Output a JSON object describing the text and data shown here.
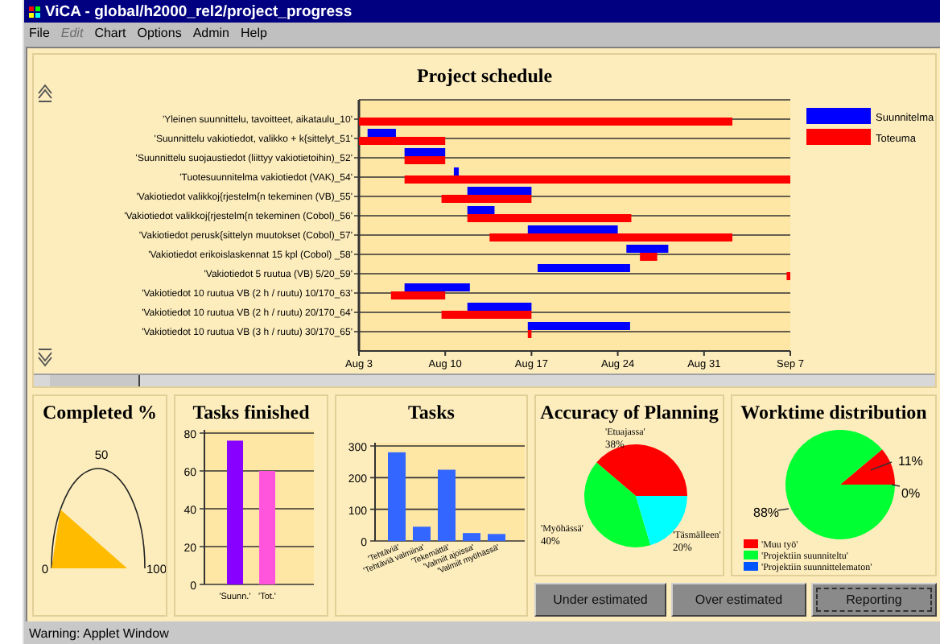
{
  "window": {
    "title": "ViCA - global/h2000_rel2/project_progress"
  },
  "menu": [
    {
      "label": "File",
      "disabled": false
    },
    {
      "label": "Edit",
      "disabled": true
    },
    {
      "label": "Chart",
      "disabled": false
    },
    {
      "label": "Options",
      "disabled": false
    },
    {
      "label": "Admin",
      "disabled": false
    },
    {
      "label": "Help",
      "disabled": false
    }
  ],
  "schedule": {
    "title": "Project schedule",
    "tasks": [
      {
        "label": "'Yleinen suunnittelu, tavoitteet, aikataulu_10'"
      },
      {
        "label": "'Suunnittelu vakiotiedot, valikko + k{sittelyt_51'"
      },
      {
        "label": "'Suunnittelu suojaustiedot (liittyy vakiotietoihin)_52'"
      },
      {
        "label": "'Tuotesuunnitelma vakiotiedot (VAK)_54'"
      },
      {
        "label": "'Vakiotiedot valikkoj{rjestelm{n tekeminen (VB)_55'"
      },
      {
        "label": "'Vakiotiedot valikkoj{rjestelm{n tekeminen (Cobol)_56'"
      },
      {
        "label": "'Vakiotiedot perusk{sittelyn muutokset (Cobol)_57'"
      },
      {
        "label": "'Vakiotiedot erikoislaskennat 15 kpl (Cobol) _58'"
      },
      {
        "label": "'Vakiotiedot 5 ruutua (VB)    5/20_59'"
      },
      {
        "label": "'Vakiotiedot 10 ruutua VB (2 h / ruutu) 10/170_63'"
      },
      {
        "label": "'Vakiotiedot 10 ruutua VB (2 h / ruutu) 20/170_64'"
      },
      {
        "label": "'Vakiotiedot 10 ruutua VB (3 h / ruutu) 30/170_65'"
      }
    ],
    "legend": [
      {
        "label": "Suunnitelma",
        "color": "#0000ff"
      },
      {
        "label": "Toteuma",
        "color": "#ff0000"
      }
    ],
    "axis_labels": [
      "Aug 3",
      "Aug 10",
      "Aug 17",
      "Aug 24",
      "Aug 31",
      "Sep 7"
    ]
  },
  "completed": {
    "title": "Completed %",
    "gauge": {
      "labels": [
        "0",
        "50",
        "100"
      ]
    }
  },
  "tasks_finished": {
    "chart_data": {
      "type": "bar",
      "title": "Tasks finished",
      "categories": [
        "'Suunn.'",
        "'Tot.'"
      ],
      "colors": [
        "#8800ff",
        "#ff55dd"
      ],
      "series": [
        {
          "values": [
            76,
            60
          ]
        }
      ],
      "ylim": [
        0,
        80
      ],
      "yticks": [
        0,
        20,
        40,
        60,
        80
      ],
      "grid": true
    }
  },
  "tasks": {
    "chart_data": {
      "type": "bar",
      "title": "Tasks",
      "categories": [
        "'Tehtäviä'",
        "'Tehtäviä valmiina'",
        "'Tekemättä'",
        "'Valmiit ajoissa'",
        "'Valmiit myöhässä'"
      ],
      "colors": [
        "#3366ff",
        "#3366ff",
        "#3366ff",
        "#3366ff",
        "#3366ff"
      ],
      "series": [
        {
          "values": [
            280,
            45,
            225,
            25,
            22
          ]
        }
      ],
      "ylim": [
        0,
        300
      ],
      "yticks": [
        0,
        100,
        200,
        300
      ],
      "grid": true
    }
  },
  "accuracy": {
    "chart_data": {
      "type": "pie",
      "title": "Accuracy of Planning",
      "categories": [
        "'Etuajassa'",
        "'Myöhässä'",
        "'Täsmälleen'"
      ],
      "colors": [
        "#ff0000",
        "#00ff33",
        "#00ffff"
      ],
      "series": [
        {
          "values": [
            38.8,
            40.8,
            20.4
          ]
        }
      ],
      "value_labels": [
        "38%",
        "40%",
        "20%"
      ]
    }
  },
  "worktime": {
    "chart_data": {
      "type": "pie",
      "title": "Worktime distribution",
      "categories": [
        "'Muu työ'",
        "'Projektiin suunniteltu'",
        "'Projektiin suunnittelematon'"
      ],
      "colors": [
        "#ff0000",
        "#00ff33",
        "#0055ff"
      ],
      "series": [
        {
          "values": [
            11,
            88,
            0
          ]
        }
      ],
      "legend": "bottom",
      "value_labels": [
        "11%",
        "88%",
        "0%"
      ]
    }
  },
  "buttons": [
    {
      "label": "Under estimated",
      "focused": false
    },
    {
      "label": "Over estimated",
      "focused": false
    },
    {
      "label": "Reporting",
      "focused": true
    }
  ],
  "status_bar": "Warning: Applet Window"
}
